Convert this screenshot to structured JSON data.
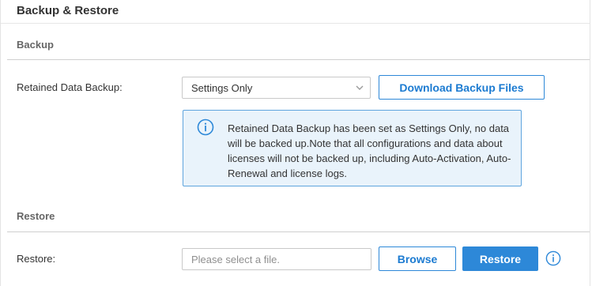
{
  "page": {
    "title": "Backup & Restore"
  },
  "backup": {
    "section_title": "Backup",
    "retained_label": "Retained Data Backup:",
    "retained_value": "Settings Only",
    "download_button": "Download Backup Files",
    "info_text": "Retained Data Backup has been set as Settings Only, no data will be backed up.Note that all configurations and data about licenses will not be backed up, including Auto-Activation, Auto-Renewal and license logs."
  },
  "restore": {
    "section_title": "Restore",
    "restore_label": "Restore:",
    "file_placeholder": "Please select a file.",
    "browse_button": "Browse",
    "restore_button": "Restore"
  },
  "colors": {
    "accent": "#2d88d8",
    "info_bg": "#e9f3fb",
    "info_border": "#5fa5de"
  },
  "icons": {
    "select_chevron": "chevron-down-icon",
    "info_notice": "info-icon",
    "restore_help": "info-icon"
  }
}
